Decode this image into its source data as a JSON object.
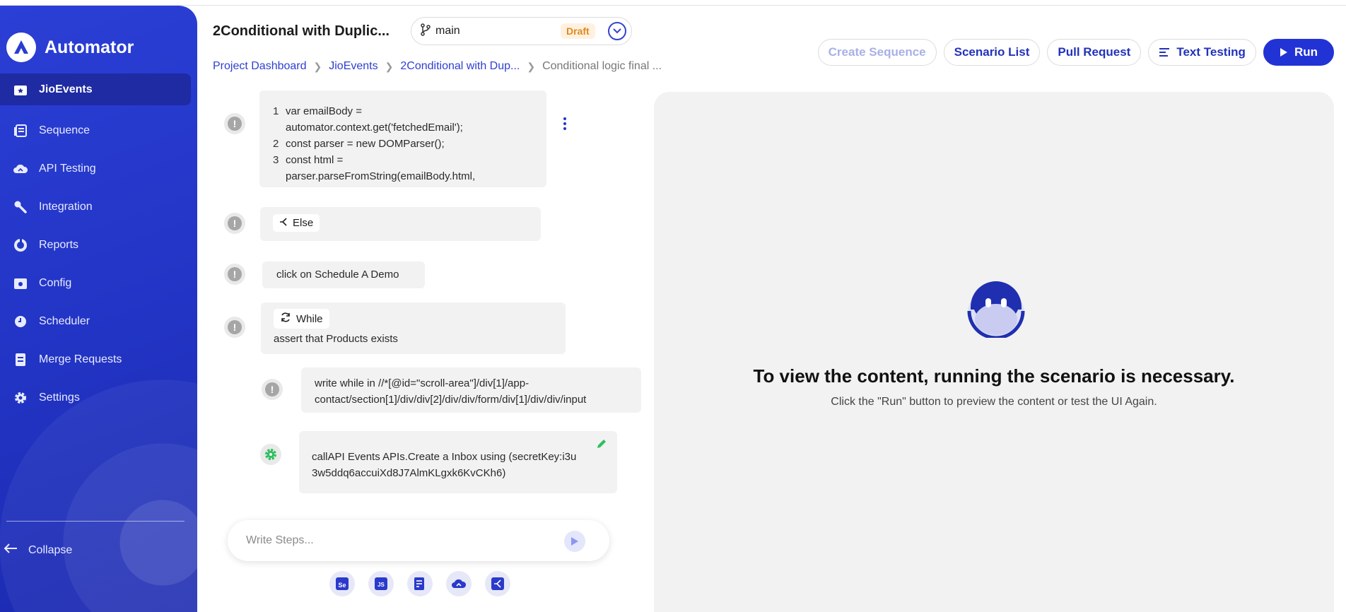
{
  "app": {
    "name": "Automator"
  },
  "sidebar": {
    "items": [
      {
        "label": "JioEvents",
        "icon": "star-folder-icon"
      },
      {
        "label": "Sequence",
        "icon": "list-icon"
      },
      {
        "label": "API Testing",
        "icon": "cloud-sync-icon"
      },
      {
        "label": "Integration",
        "icon": "wrench-icon"
      },
      {
        "label": "Reports",
        "icon": "pie-chart-icon"
      },
      {
        "label": "Config",
        "icon": "config-icon"
      },
      {
        "label": "Scheduler",
        "icon": "clock-icon"
      },
      {
        "label": "Merge Requests",
        "icon": "merge-list-icon"
      },
      {
        "label": "Settings",
        "icon": "gear-icon"
      }
    ],
    "collapse_label": "Collapse"
  },
  "header": {
    "title": "2Conditional with Duplic...",
    "branch": "main",
    "draft_label": "Draft",
    "breadcrumb": [
      "Project Dashboard",
      "JioEvents",
      "2Conditional with Dup...",
      "Conditional logic final ..."
    ],
    "buttons": {
      "create_sequence": "Create Sequence",
      "scenario_list": "Scenario List",
      "pull_request": "Pull Request",
      "text_testing": "Text Testing",
      "run": "Run"
    }
  },
  "steps": {
    "code_lines": [
      {
        "num": "1",
        "text": "var emailBody ="
      },
      {
        "num": "",
        "text": "automator.context.get('fetchedEmail');"
      },
      {
        "num": "2",
        "text": "const parser = new DOMParser();"
      },
      {
        "num": "3",
        "text": "const html ="
      },
      {
        "num": "",
        "text": "parser.parseFromString(emailBody.html,"
      }
    ],
    "else_label": "Else",
    "click_step": "click on Schedule A Demo",
    "while_label": "While",
    "while_condition": "assert that Products exists",
    "write_step_line1": "write while in //*[@id=\"scroll-area\"]/div[1]/app-",
    "write_step_line2": "contact/section[1]/div/div[2]/div/div/form/div[1]/div/div/input",
    "callapi_line1": "callAPI Events APIs.Create a Inbox using (secretKey:i3u",
    "callapi_line2": "3w5ddq6accuiXd8J7AlmKLgxk6KvCKh6)",
    "input_placeholder": "Write Steps..."
  },
  "preview": {
    "message": "To view the content, running the scenario is necessary.",
    "sub": "Click the \"Run\" button to preview the content or test the UI Again."
  }
}
